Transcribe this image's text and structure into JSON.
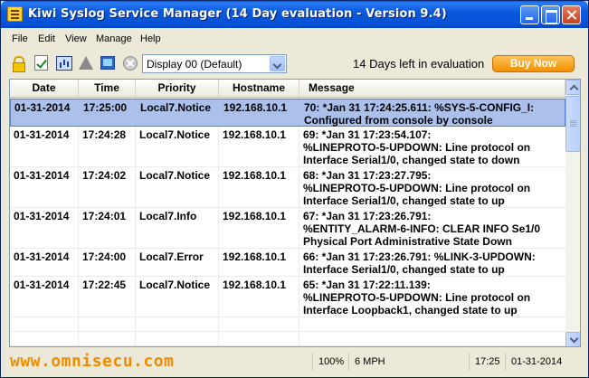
{
  "window": {
    "title": "Kiwi Syslog Service Manager (14 Day evaluation - Version 9.4)"
  },
  "menu": [
    "File",
    "Edit",
    "View",
    "Manage",
    "Help"
  ],
  "toolbar": {
    "icons": [
      "lock-icon",
      "checklist-icon",
      "chart-icon",
      "warning-icon",
      "display-icon",
      "stop-icon"
    ],
    "display_select": "Display 00 (Default)",
    "evaluation_text": "14 Days left in evaluation",
    "buy_label": "Buy Now"
  },
  "table": {
    "columns": [
      "Date",
      "Time",
      "Priority",
      "Hostname",
      "Message"
    ],
    "rows": [
      {
        "date": "01-31-2014",
        "time": "17:25:00",
        "priority": "Local7.Notice",
        "hostname": "192.168.10.1",
        "message": [
          "70: *Jan 31 17:24:25.611: %SYS-5-CONFIG_I:",
          "Configured from console by console"
        ],
        "selected": true
      },
      {
        "date": "01-31-2014",
        "time": "17:24:28",
        "priority": "Local7.Notice",
        "hostname": "192.168.10.1",
        "message": [
          "69: *Jan 31 17:23:54.107:",
          "%LINEPROTO-5-UPDOWN: Line protocol on",
          "Interface Serial1/0, changed state to down"
        ]
      },
      {
        "date": "01-31-2014",
        "time": "17:24:02",
        "priority": "Local7.Notice",
        "hostname": "192.168.10.1",
        "message": [
          "68: *Jan 31 17:23:27.795:",
          "%LINEPROTO-5-UPDOWN: Line protocol on",
          "Interface Serial1/0, changed state to up"
        ]
      },
      {
        "date": "01-31-2014",
        "time": "17:24:01",
        "priority": "Local7.Info",
        "hostname": "192.168.10.1",
        "message": [
          "67: *Jan 31 17:23:26.791:",
          "%ENTITY_ALARM-6-INFO: CLEAR INFO Se1/0",
          "Physical Port Administrative State Down"
        ]
      },
      {
        "date": "01-31-2014",
        "time": "17:24:00",
        "priority": "Local7.Error",
        "hostname": "192.168.10.1",
        "message": [
          "66: *Jan 31 17:23:26.791: %LINK-3-UPDOWN:",
          "Interface Serial1/0, changed state to up"
        ]
      },
      {
        "date": "01-31-2014",
        "time": "17:22:45",
        "priority": "Local7.Notice",
        "hostname": "192.168.10.1",
        "message": [
          "65: *Jan 31 17:22:11.139:",
          "%LINEPROTO-5-UPDOWN: Line protocol on",
          "Interface Loopback1, changed state to up"
        ]
      }
    ]
  },
  "statusbar": {
    "site": "www.omnisecu.com",
    "zoom": "100%",
    "rate": "6 MPH",
    "time": "17:25",
    "date": "01-31-2014"
  }
}
